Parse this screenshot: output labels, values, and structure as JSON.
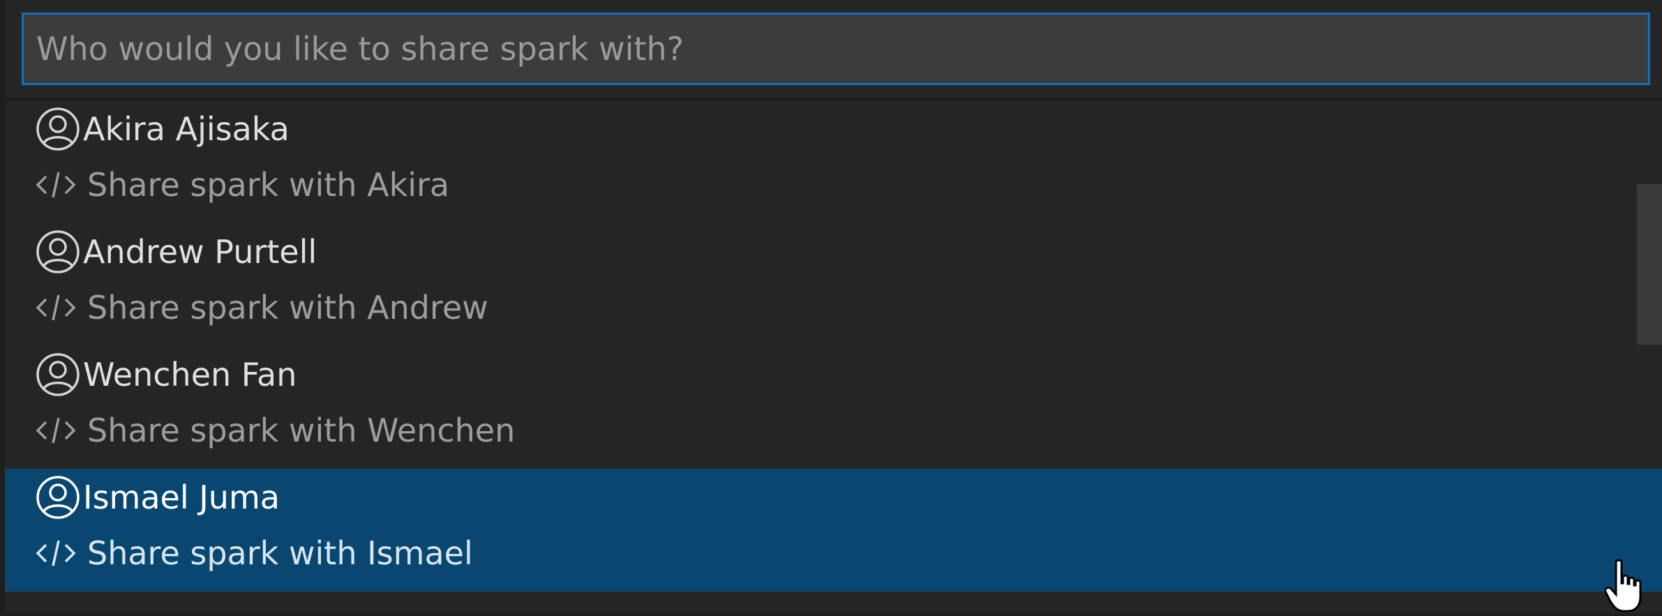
{
  "quick_pick": {
    "input": {
      "placeholder": "Who would you like to share spark with?",
      "value": ""
    },
    "items": [
      {
        "name": "Akira Ajisaka",
        "description": "Share spark with Akira",
        "user_icon": "account-icon",
        "desc_icon": "code-icon",
        "selected": false
      },
      {
        "name": "Andrew Purtell",
        "description": "Share spark with Andrew",
        "user_icon": "account-icon",
        "desc_icon": "code-icon",
        "selected": false
      },
      {
        "name": "Wenchen Fan",
        "description": "Share spark with Wenchen",
        "user_icon": "account-icon",
        "desc_icon": "code-icon",
        "selected": false
      },
      {
        "name": "Ismael Juma",
        "description": "Share spark with Ismael",
        "user_icon": "account-icon",
        "desc_icon": "code-icon",
        "selected": true
      }
    ]
  },
  "colors": {
    "background": "#252526",
    "input_border": "#0e70c0",
    "input_background": "#3c3c3c",
    "selected_background": "#094771",
    "text": "#e0e0e0",
    "description_text": "#9d9d9d"
  },
  "cursor": "hand-pointer-icon"
}
